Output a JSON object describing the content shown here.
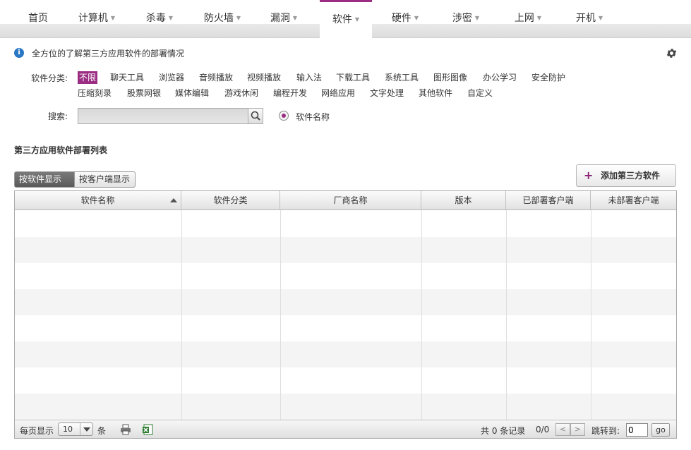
{
  "nav": {
    "items": [
      {
        "label": "首页",
        "caret": false
      },
      {
        "label": "计算机",
        "caret": true
      },
      {
        "label": "杀毒",
        "caret": true
      },
      {
        "label": "防火墙",
        "caret": true
      },
      {
        "label": "漏洞",
        "caret": true
      },
      {
        "label": "软件",
        "caret": true,
        "active": true
      },
      {
        "label": "硬件",
        "caret": true
      },
      {
        "label": "涉密",
        "caret": true
      },
      {
        "label": "上网",
        "caret": true
      },
      {
        "label": "开机",
        "caret": true
      }
    ],
    "caret_glyph": "▼",
    "accent_color": "#9b2e82"
  },
  "info": {
    "icon_glyph": "i",
    "text": "全方位的了解第三方应用软件的部署情况"
  },
  "filter": {
    "label": "软件分类:",
    "categories_row1": [
      "不限",
      "聊天工具",
      "浏览器",
      "音频播放",
      "视频播放",
      "输入法",
      "下载工具",
      "系统工具",
      "图形图像",
      "办公学习",
      "安全防护"
    ],
    "categories_row2": [
      "压缩刻录",
      "股票网银",
      "媒体编辑",
      "游戏休闲",
      "编程开发",
      "网络应用",
      "文字处理",
      "其他软件",
      "自定义"
    ],
    "selected": "不限"
  },
  "search": {
    "label": "搜索:",
    "value": "",
    "placeholder": "",
    "radio_label": "软件名称"
  },
  "section": {
    "title": "第三方应用软件部署列表"
  },
  "view_toggle": {
    "by_software": "按软件显示",
    "by_client": "按客户端显示"
  },
  "add_button": {
    "plus": "+",
    "label": "添加第三方软件"
  },
  "table": {
    "columns": [
      "软件名称",
      "软件分类",
      "厂商名称",
      "版本",
      "已部署客户端",
      "未部署客户端"
    ],
    "rows": []
  },
  "footer": {
    "per_page_label": "每页显示",
    "per_page_value": "10",
    "per_page_unit": "条",
    "total_label": "共 0 条记录",
    "page_indicator": "0/0",
    "prev_glyph": "<",
    "next_glyph": ">",
    "jump_label": "跳转到:",
    "jump_value": "0",
    "go_label": "go"
  }
}
